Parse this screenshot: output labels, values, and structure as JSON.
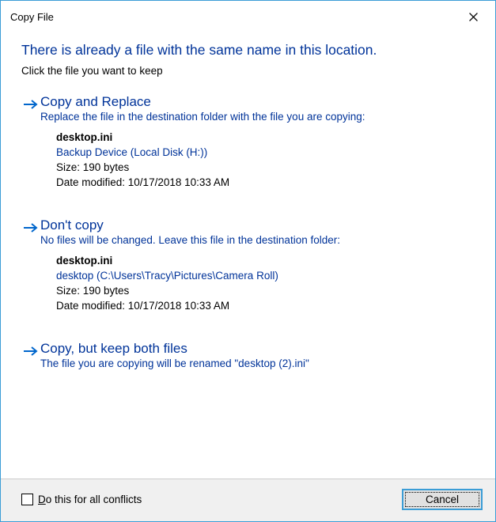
{
  "title": "Copy File",
  "heading": "There is already a file with the same name in this location.",
  "subheading": "Click the file you want to keep",
  "options": [
    {
      "title": "Copy and Replace",
      "desc": "Replace the file in the destination folder with the file you are copying:",
      "file": {
        "name": "desktop.ini",
        "location": "Backup Device (Local Disk (H:))",
        "size": "Size: 190 bytes",
        "modified": "Date modified: 10/17/2018 10:33 AM"
      }
    },
    {
      "title": "Don't copy",
      "desc": "No files will be changed. Leave this file in the destination folder:",
      "file": {
        "name": "desktop.ini",
        "location": "desktop (C:\\Users\\Tracy\\Pictures\\Camera Roll)",
        "size": "Size: 190 bytes",
        "modified": "Date modified: 10/17/2018 10:33 AM"
      }
    },
    {
      "title": "Copy, but keep both files",
      "desc": "The file you are copying will be renamed \"desktop (2).ini\""
    }
  ],
  "footer": {
    "checkbox_label_pre": "D",
    "checkbox_label_rest": "o this for all conflicts",
    "cancel": "Cancel"
  }
}
